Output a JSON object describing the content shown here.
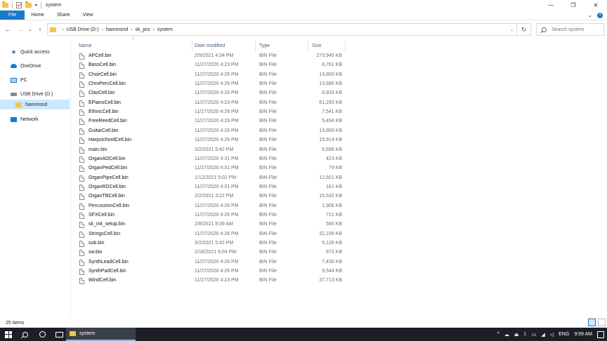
{
  "window": {
    "title": "system",
    "controls": {
      "minimize": "—",
      "maximize": "❐",
      "close": "✕"
    }
  },
  "ribbon": {
    "tabs": [
      "File",
      "Home",
      "Share",
      "View"
    ],
    "help": "?",
    "expand": "⌄"
  },
  "nav": {
    "back": "←",
    "forward": "→",
    "recent": "⌄",
    "up": "↑"
  },
  "address": {
    "crumbs": [
      "USB Drive (D:)",
      "hammond",
      "sk_pro",
      "system"
    ],
    "refresh": "↻"
  },
  "search": {
    "placeholder": "Search system"
  },
  "sidebar": {
    "items": [
      {
        "label": "Quick access",
        "icon": "star-icon"
      },
      {
        "label": "OneDrive",
        "icon": "cloud-icon"
      },
      {
        "label": "PC",
        "icon": "pc-icon"
      },
      {
        "label": "USB Drive (D:)",
        "icon": "drive-icon"
      },
      {
        "label": "hammond",
        "icon": "folder-icon",
        "selected": true
      },
      {
        "label": "Network",
        "icon": "network-icon"
      }
    ]
  },
  "columns": {
    "name": "Name",
    "date": "Date modified",
    "type": "Type",
    "size": "Size",
    "sort_indicator": "^"
  },
  "files": [
    {
      "name": "APCell.bin",
      "date": "2/9/2021 4:34 PM",
      "type": "BIN File",
      "size": "273,945 KB"
    },
    {
      "name": "BassCell.bin",
      "date": "11/27/2020 4:23 PM",
      "type": "BIN File",
      "size": "6,761 KB"
    },
    {
      "name": "ChoirCell.bin",
      "date": "11/27/2020 4:26 PM",
      "type": "BIN File",
      "size": "13,800 KB"
    },
    {
      "name": "ChroPercCell.bin",
      "date": "11/27/2020 4:26 PM",
      "type": "BIN File",
      "size": "13,685 KB"
    },
    {
      "name": "ClavCell.bin",
      "date": "11/27/2020 4:26 PM",
      "type": "BIN File",
      "size": "8,933 KB"
    },
    {
      "name": "EPianoCell.bin",
      "date": "11/27/2020 4:23 PM",
      "type": "BIN File",
      "size": "61,293 KB"
    },
    {
      "name": "EthnicCell.bin",
      "date": "11/27/2020 4:26 PM",
      "type": "BIN File",
      "size": "7,541 KB"
    },
    {
      "name": "FreeReedCell.bin",
      "date": "11/27/2020 4:26 PM",
      "type": "BIN File",
      "size": "5,494 KB"
    },
    {
      "name": "GuitarCell.bin",
      "date": "11/27/2020 4:26 PM",
      "type": "BIN File",
      "size": "13,800 KB"
    },
    {
      "name": "HarpsichordCell.bin",
      "date": "11/27/2020 4:26 PM",
      "type": "BIN File",
      "size": "15,914 KB"
    },
    {
      "name": "main.bin",
      "date": "3/2/2021 5:42 PM",
      "type": "BIN File",
      "size": "6,606 KB"
    },
    {
      "name": "OrganADCell.bin",
      "date": "11/27/2020 4:31 PM",
      "type": "BIN File",
      "size": "423 KB"
    },
    {
      "name": "OrganPedCell.bin",
      "date": "11/27/2020 4:31 PM",
      "type": "BIN File",
      "size": "79 KB"
    },
    {
      "name": "OrganPipeCell.bin",
      "date": "1/12/2021 5:02 PM",
      "type": "BIN File",
      "size": "12,921 KB"
    },
    {
      "name": "OrganRDCell.bin",
      "date": "11/27/2020 4:31 PM",
      "type": "BIN File",
      "size": "161 KB"
    },
    {
      "name": "OrganTBCell.bin",
      "date": "2/2/2021 3:22 PM",
      "type": "BIN File",
      "size": "15,532 KB"
    },
    {
      "name": "PercussionCell.bin",
      "date": "11/27/2020 4:26 PM",
      "type": "BIN File",
      "size": "1,906 KB"
    },
    {
      "name": "SFXCell.bin",
      "date": "11/27/2020 4:26 PM",
      "type": "BIN File",
      "size": "721 KB"
    },
    {
      "name": "sk_init_setup.bin",
      "date": "2/8/2021 9:39 AM",
      "type": "BIN File",
      "size": "566 KB"
    },
    {
      "name": "StringsCell.bin",
      "date": "11/27/2020 4:26 PM",
      "type": "BIN File",
      "size": "32,158 KB"
    },
    {
      "name": "sub.bin",
      "date": "3/2/2021 5:42 PM",
      "type": "BIN File",
      "size": "5,129 KB"
    },
    {
      "name": "sw.bin",
      "date": "2/16/2021 6:04 PM",
      "type": "BIN File",
      "size": "873 KB"
    },
    {
      "name": "SynthLeadCell.bin",
      "date": "11/27/2020 4:26 PM",
      "type": "BIN File",
      "size": "7,430 KB"
    },
    {
      "name": "SynthPadCell.bin",
      "date": "11/27/2020 4:26 PM",
      "type": "BIN File",
      "size": "9,544 KB"
    },
    {
      "name": "WindCell.bin",
      "date": "11/27/2020 4:23 PM",
      "type": "BIN File",
      "size": "37,713 KB"
    }
  ],
  "status": {
    "count": "25 items"
  },
  "taskbar": {
    "app_label": "system",
    "tray": {
      "chevron": "^",
      "lang": "ENG",
      "time": "9:59 AM"
    }
  },
  "colors": {
    "accent": "#1979ca",
    "selection": "#cce8ff",
    "folder": "#f1c64c",
    "taskbar": "#1c1f26"
  }
}
